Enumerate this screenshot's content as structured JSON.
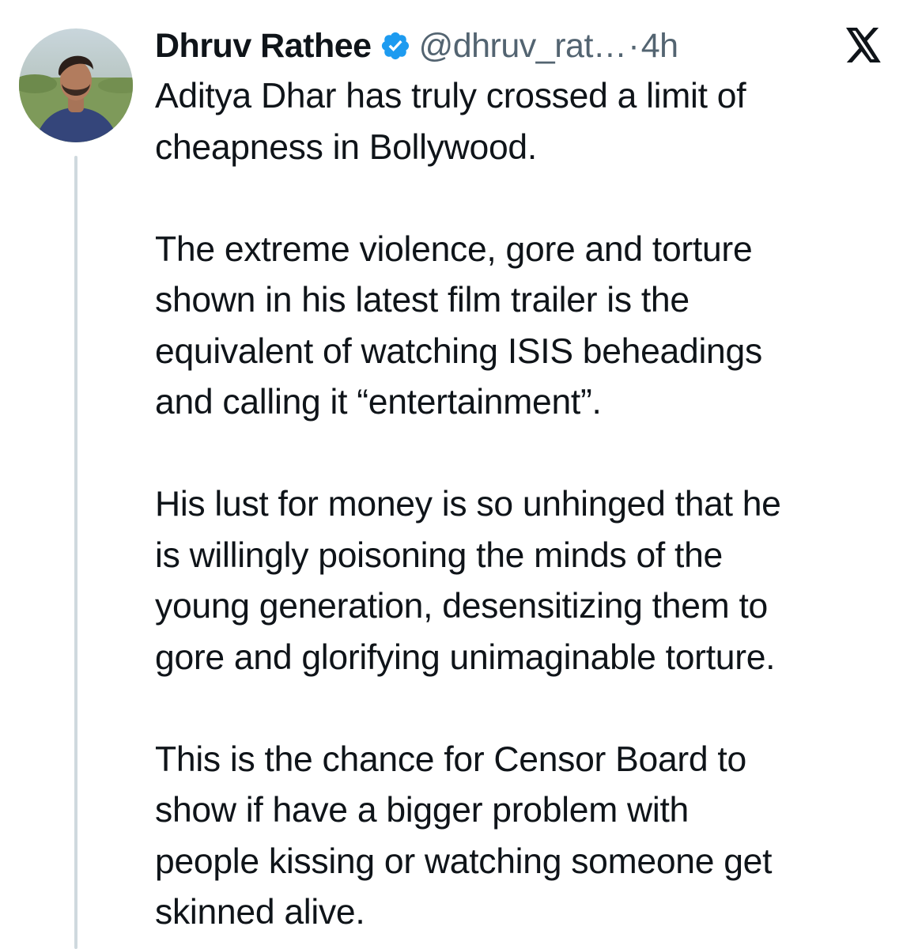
{
  "tweet": {
    "author": {
      "name": "Dhruv Rathee",
      "handle": "@dhruv_rat…",
      "verified": true,
      "avatar_icon": "profile-photo"
    },
    "separator": "·",
    "time": "4h",
    "platform_icon": "x-logo-icon",
    "paragraphs": [
      {
        "lines": [
          "Aditya Dhar has truly crossed a limit of",
          "cheapness in Bollywood."
        ]
      },
      {
        "lines": [
          "The extreme violence, gore and torture",
          "shown in his latest film trailer is the",
          "equivalent of watching ISIS beheadings",
          "and calling it “entertainment”."
        ]
      },
      {
        "lines": [
          "His lust for money is so unhinged that he",
          "is willingly poisoning the minds of the",
          "young generation, desensitizing them to",
          "gore and glorifying unimaginable torture."
        ]
      },
      {
        "lines": [
          "This is the chance for Censor Board to",
          "show if have a bigger problem with",
          "people kissing or watching someone get",
          "skinned alive."
        ]
      }
    ]
  },
  "colors": {
    "text_primary": "#0f1419",
    "text_secondary": "#536471",
    "verified_blue": "#1d9bf0",
    "thread_line": "#cfd9de"
  }
}
